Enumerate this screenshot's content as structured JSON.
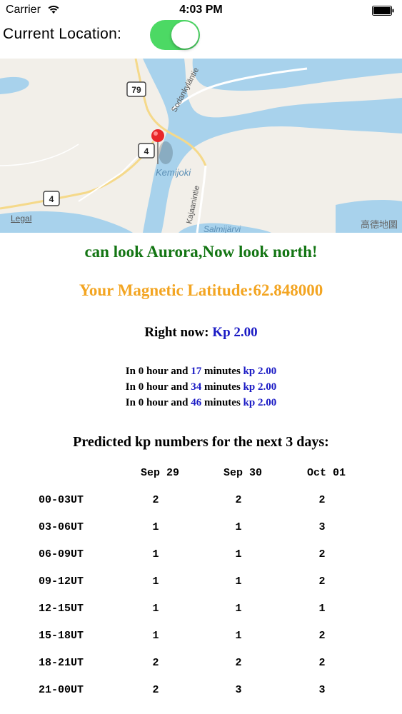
{
  "status_bar": {
    "carrier": "Carrier",
    "time": "4:03 PM"
  },
  "location": {
    "label": "Current Location:",
    "toggle_on": true,
    "toggle_color": "#4cd964"
  },
  "map": {
    "road_79": "79",
    "road_4_a": "4",
    "road_4_b": "4",
    "road_sodankylantie": "Sodankyläntie",
    "river_kemijoki": "Kemijoki",
    "road_kajaanintie": "Kajaanintie",
    "lake_salmijarvi": "Salmijärvi",
    "legal": "Legal",
    "attribution": "高德地圖"
  },
  "aurora": {
    "status_message": "can look Aurora,Now look north!",
    "magnetic_latitude_label": "Your Magnetic Latitude:",
    "magnetic_latitude_value": "62.848000",
    "right_now_label": "Right now:",
    "right_now_value": "Kp 2.00",
    "forecasts": [
      {
        "prefix": "In 0 hour and",
        "minutes": "17",
        "suffix": "minutes",
        "kp": "kp 2.00"
      },
      {
        "prefix": "In 0 hour and",
        "minutes": "34",
        "suffix": "minutes",
        "kp": "kp 2.00"
      },
      {
        "prefix": "In 0 hour and",
        "minutes": "46",
        "suffix": "minutes",
        "kp": "kp 2.00"
      }
    ],
    "colors": {
      "status_green": "#137513",
      "latitude_orange": "#f3a522",
      "kp_blue": "#1a1ac4"
    }
  },
  "prediction": {
    "title": "Predicted kp numbers for the next 3 days:",
    "days": [
      "Sep 29",
      "Sep 30",
      "Oct 01"
    ],
    "rows": [
      {
        "time": "00-03UT",
        "values": [
          "2",
          "2",
          "2"
        ]
      },
      {
        "time": "03-06UT",
        "values": [
          "1",
          "1",
          "3"
        ]
      },
      {
        "time": "06-09UT",
        "values": [
          "1",
          "1",
          "2"
        ]
      },
      {
        "time": "09-12UT",
        "values": [
          "1",
          "1",
          "2"
        ]
      },
      {
        "time": "12-15UT",
        "values": [
          "1",
          "1",
          "1"
        ]
      },
      {
        "time": "15-18UT",
        "values": [
          "1",
          "1",
          "2"
        ]
      },
      {
        "time": "18-21UT",
        "values": [
          "2",
          "2",
          "2"
        ]
      },
      {
        "time": "21-00UT",
        "values": [
          "2",
          "3",
          "3"
        ]
      }
    ]
  }
}
